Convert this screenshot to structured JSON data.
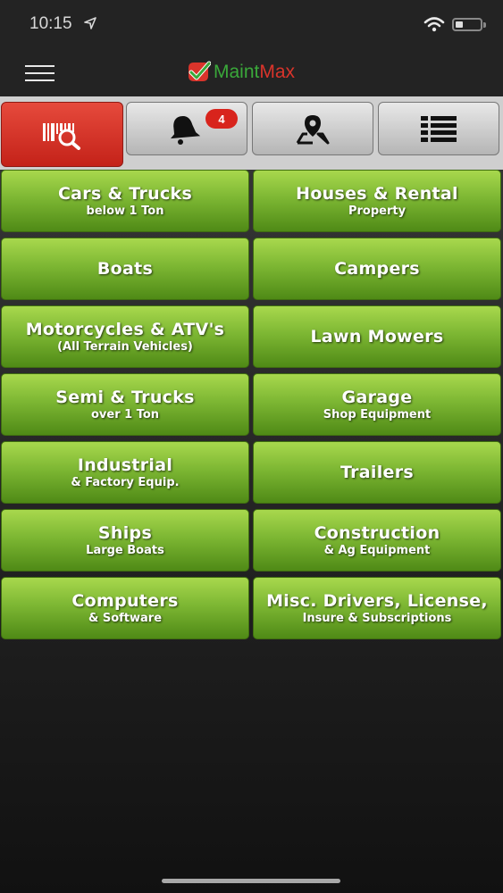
{
  "status_bar": {
    "time": "10:15"
  },
  "header": {
    "logo_part1": "Maint",
    "logo_part2": "Max",
    "colors": {
      "logo_green": "#3aa83a",
      "logo_red": "#d9342b"
    }
  },
  "toolbar": {
    "items": [
      {
        "icon": "barcode-search-icon",
        "active": true
      },
      {
        "icon": "bell-icon",
        "badge": "4"
      },
      {
        "icon": "map-pin-icon"
      },
      {
        "icon": "list-icon"
      }
    ],
    "colors": {
      "active": "#d8342a",
      "inactive": "#c8c8c8"
    }
  },
  "categories": [
    {
      "main": "Cars & Trucks",
      "sub": "below 1 Ton"
    },
    {
      "main": "Houses & Rental",
      "sub": "Property"
    },
    {
      "main": "Boats",
      "sub": ""
    },
    {
      "main": "Campers",
      "sub": ""
    },
    {
      "main": "Motorcycles & ATV's",
      "sub": "(All Terrain Vehicles)"
    },
    {
      "main": "Lawn Mowers",
      "sub": ""
    },
    {
      "main": "Semi & Trucks",
      "sub": "over 1 Ton"
    },
    {
      "main": "Garage",
      "sub": "Shop Equipment"
    },
    {
      "main": "Industrial",
      "sub": "& Factory Equip."
    },
    {
      "main": "Trailers",
      "sub": ""
    },
    {
      "main": "Ships",
      "sub": "Large Boats"
    },
    {
      "main": "Construction",
      "sub": "& Ag Equipment"
    },
    {
      "main": "Computers",
      "sub": "& Software"
    },
    {
      "main": "Misc. Drivers, License,",
      "sub": "Insure & Subscriptions"
    }
  ],
  "category_color": "#7db733"
}
